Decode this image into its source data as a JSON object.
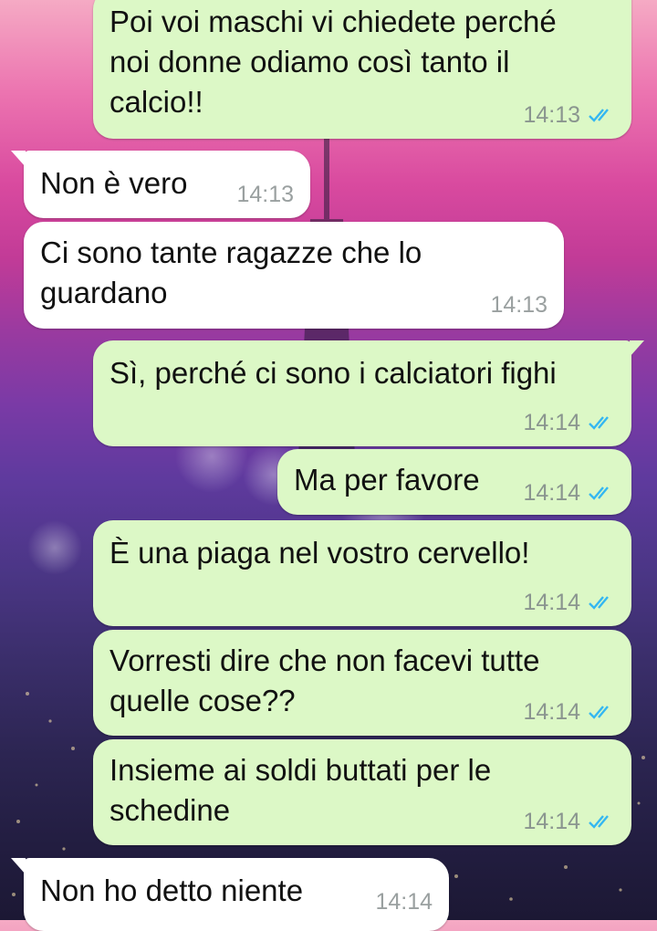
{
  "messages": [
    {
      "direction": "out",
      "text": "Poi voi maschi vi chiedete perché\nnoi donne odiamo così tanto il\ncalcio!!",
      "time": "14:13",
      "status_icon": "double-check-blue-icon"
    },
    {
      "direction": "in",
      "text": "Non è vero",
      "time": "14:13"
    },
    {
      "direction": "in",
      "text": "Ci sono tante ragazze che lo\nguardano",
      "time": "14:13"
    },
    {
      "direction": "out",
      "text": "Sì, perché ci sono i calciatori fighi",
      "time": "14:14",
      "status_icon": "double-check-blue-icon"
    },
    {
      "direction": "out",
      "text": "Ma per favore",
      "time": "14:14",
      "status_icon": "double-check-blue-icon"
    },
    {
      "direction": "out",
      "text": "È una piaga nel vostro cervello!",
      "time": "14:14",
      "status_icon": "double-check-blue-icon"
    },
    {
      "direction": "out",
      "text": "Vorresti dire che non facevi tutte\nquelle cose??",
      "time": "14:14",
      "status_icon": "double-check-blue-icon"
    },
    {
      "direction": "out",
      "text": "Insieme ai soldi buttati per le\nschedine",
      "time": "14:14",
      "status_icon": "double-check-blue-icon"
    },
    {
      "direction": "in",
      "text": "Non ho detto niente",
      "time": "14:14"
    }
  ],
  "colors": {
    "outgoing_bubble": "#dcf8c6",
    "incoming_bubble": "#ffffff",
    "read_check": "#34b7f1",
    "timestamp": "#8a958f"
  }
}
